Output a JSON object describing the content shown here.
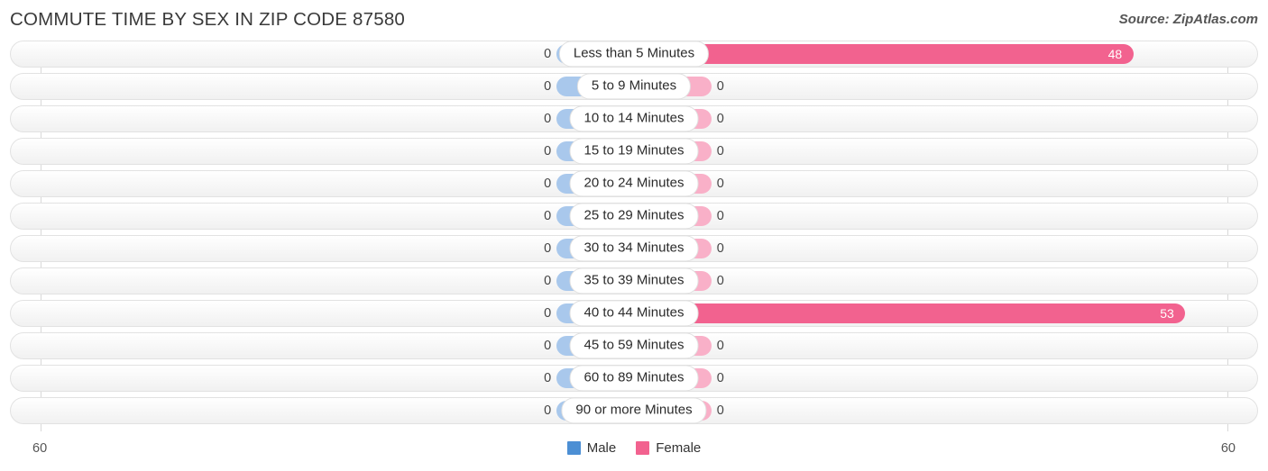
{
  "header": {
    "title": "COMMUTE TIME BY SEX IN ZIP CODE 87580",
    "source": "Source: ZipAtlas.com"
  },
  "legend": {
    "male_label": "Male",
    "female_label": "Female",
    "male_color": "#4c8fd4",
    "female_color": "#f2628f"
  },
  "axis": {
    "left_tick": "60",
    "right_tick": "60",
    "max": 60
  },
  "colors": {
    "male_bar": "#aac8ec",
    "female_bar_zero": "#f9b0c8",
    "female_bar_value": "#f2628f",
    "track_border": "#e2e2e2",
    "title": "#3a3a3a"
  },
  "chart_data": {
    "type": "bar",
    "title": "COMMUTE TIME BY SEX IN ZIP CODE 87580",
    "subtitle": "Source: ZipAtlas.com",
    "orientation": "horizontal-diverging",
    "xlabel": "",
    "ylabel": "",
    "xlim": [
      60,
      60
    ],
    "grid": false,
    "legend_position": "bottom-center",
    "categories": [
      "Less than 5 Minutes",
      "5 to 9 Minutes",
      "10 to 14 Minutes",
      "15 to 19 Minutes",
      "20 to 24 Minutes",
      "25 to 29 Minutes",
      "30 to 34 Minutes",
      "35 to 39 Minutes",
      "40 to 44 Minutes",
      "45 to 59 Minutes",
      "60 to 89 Minutes",
      "90 or more Minutes"
    ],
    "series": [
      {
        "name": "Male",
        "values": [
          0,
          0,
          0,
          0,
          0,
          0,
          0,
          0,
          0,
          0,
          0,
          0
        ]
      },
      {
        "name": "Female",
        "values": [
          48,
          0,
          0,
          0,
          0,
          0,
          0,
          0,
          53,
          0,
          0,
          0
        ]
      }
    ]
  },
  "rows": [
    {
      "label": "Less than 5 Minutes",
      "male": "0",
      "female": "48"
    },
    {
      "label": "5 to 9 Minutes",
      "male": "0",
      "female": "0"
    },
    {
      "label": "10 to 14 Minutes",
      "male": "0",
      "female": "0"
    },
    {
      "label": "15 to 19 Minutes",
      "male": "0",
      "female": "0"
    },
    {
      "label": "20 to 24 Minutes",
      "male": "0",
      "female": "0"
    },
    {
      "label": "25 to 29 Minutes",
      "male": "0",
      "female": "0"
    },
    {
      "label": "30 to 34 Minutes",
      "male": "0",
      "female": "0"
    },
    {
      "label": "35 to 39 Minutes",
      "male": "0",
      "female": "0"
    },
    {
      "label": "40 to 44 Minutes",
      "male": "0",
      "female": "53"
    },
    {
      "label": "45 to 59 Minutes",
      "male": "0",
      "female": "0"
    },
    {
      "label": "60 to 89 Minutes",
      "male": "0",
      "female": "0"
    },
    {
      "label": "90 or more Minutes",
      "male": "0",
      "female": "0"
    }
  ]
}
